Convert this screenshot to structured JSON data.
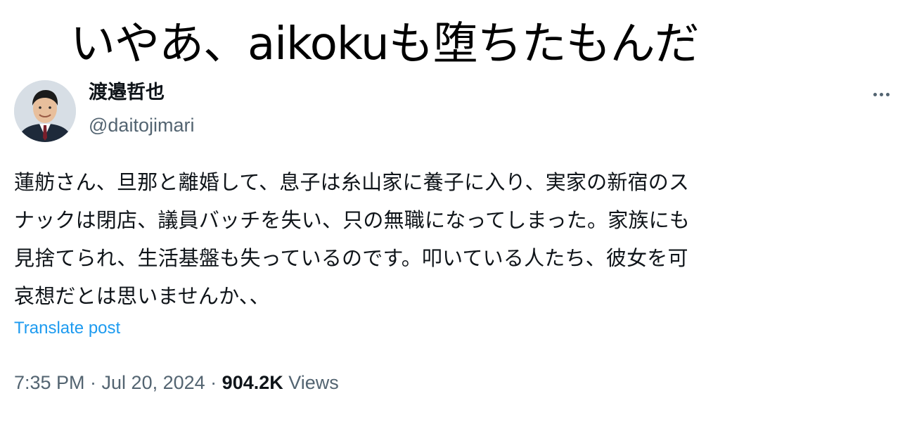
{
  "caption": "いやあ、aikokuも堕ちたもんだ",
  "post": {
    "author": {
      "display_name": "渡邉哲也",
      "handle": "@daitojimari",
      "avatar_icon": "profile-photo"
    },
    "more_icon": "more-horizontal-icon",
    "text": "蓮舫さん、旦那と離婚して、息子は糸山家に養子に入り、実家の新宿のス\nナックは閉店、議員バッチを失い、只の無職になってしまった。家族にも\n見捨てられ、生活基盤も失っているのです。叩いている人たち、彼女を可\n哀想だとは思いませんか、、",
    "translate_label": "Translate post",
    "timestamp": "7:35 PM · Jul 20, 2024",
    "separator": " · ",
    "views_count": "904.2K",
    "views_label": " Views",
    "colors": {
      "text": "#0f1419",
      "secondary": "#536471",
      "link": "#1d9bf0"
    }
  }
}
